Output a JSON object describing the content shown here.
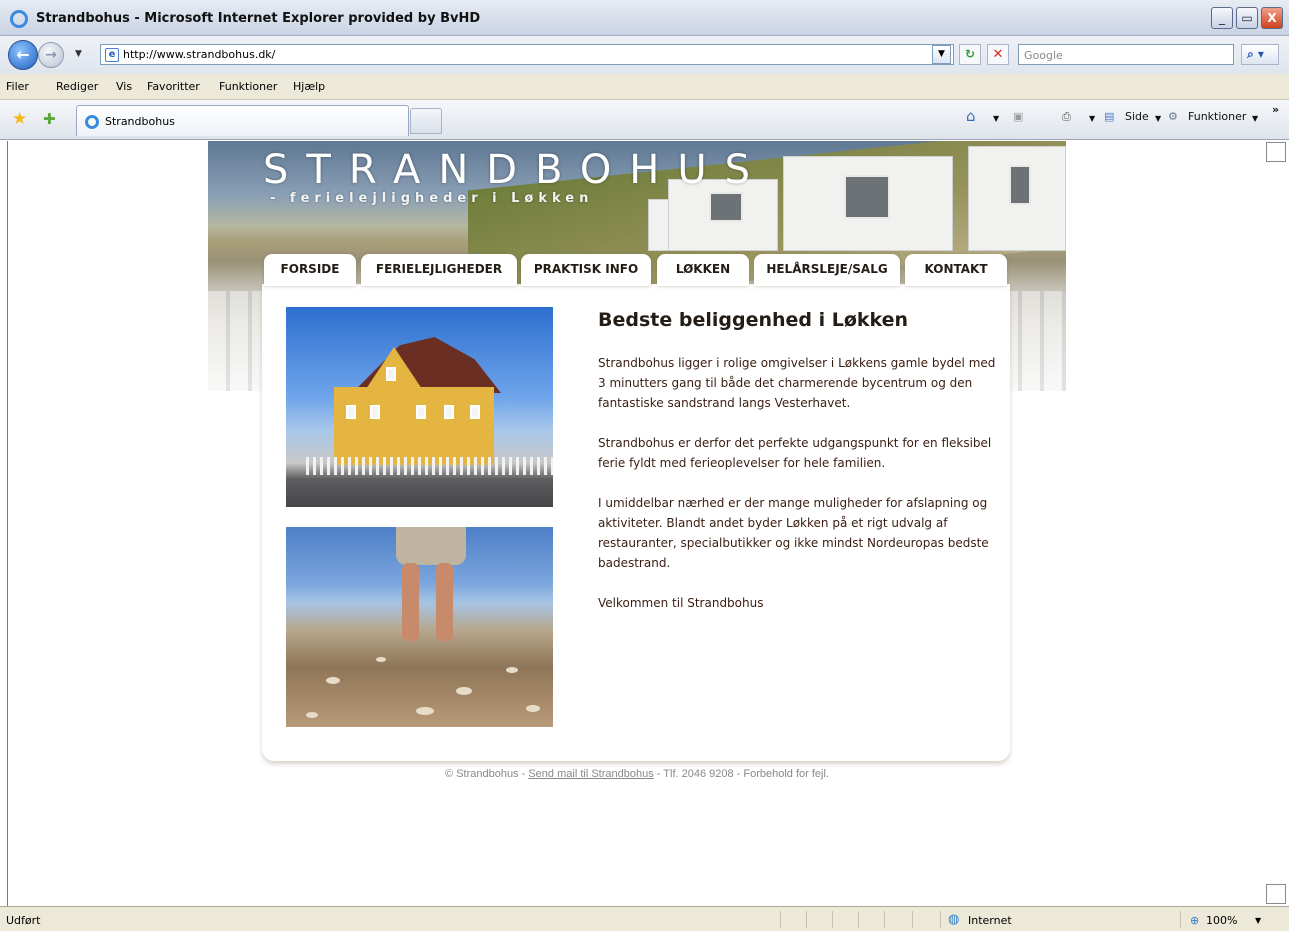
{
  "window": {
    "title": "Strandbohus - Microsoft Internet Explorer provided by BvHD",
    "minimize": "_",
    "maximize": "▭",
    "close": "X"
  },
  "address": {
    "url": "http://www.strandbohus.dk/",
    "search_placeholder": "Google"
  },
  "menu": [
    "Filer",
    "Rediger",
    "Vis",
    "Favoritter",
    "Funktioner",
    "Hjælp"
  ],
  "toolbar": {
    "tab_label": "Strandbohus",
    "side_label": "Side",
    "funktioner_label": "Funktioner",
    "overflow": "»"
  },
  "site": {
    "title": "STRANDBOHUS",
    "subtitle": "- ferielejligheder i Løkken",
    "nav": [
      "FORSIDE",
      "FERIELEJLIGHEDER",
      "PRAKTISK INFO",
      "LØKKEN",
      "HELÅRSLEJE/SALG",
      "KONTAKT"
    ],
    "heading": "Bedste beliggenhed i Løkken",
    "paragraphs": [
      "Strandbohus ligger i rolige omgivelser i Løkkens gamle bydel med 3 minutters gang til både det charmerende bycentrum og den fantastiske sandstrand langs Vesterhavet.",
      "Strandbohus er derfor det perfekte udgangspunkt for en fleksibel ferie fyldt med ferieoplevelser for hele familien.",
      "I umiddelbar nærhed er der mange muligheder for afslapning og aktiviteter. Blandt andet byder Løkken på et rigt udvalg af restauranter, specialbutikker og ikke mindst Nordeuropas bedste badestrand.",
      "Velkommen til Strandbohus"
    ],
    "footer_prefix": "© Strandbohus - ",
    "footer_link": "Send mail til Strandbohus",
    "footer_suffix": " - Tlf. 2046 9208 - Forbehold for fejl."
  },
  "status": {
    "left": "Udført",
    "zone": "Internet",
    "zoom": "100%"
  },
  "colors": {
    "nav_text": "#231d16",
    "body_text": "#3b1d12"
  }
}
